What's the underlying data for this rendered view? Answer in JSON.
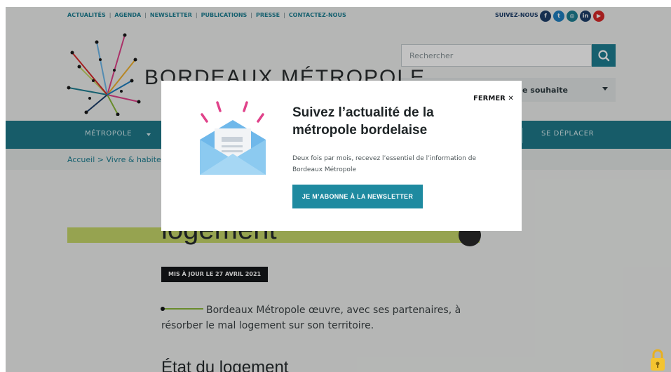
{
  "topbar": {
    "links": [
      "ACTUALITÉS",
      "AGENDA",
      "NEWSLETTER",
      "PUBLICATIONS",
      "PRESSE",
      "CONTACTEZ-NOUS"
    ],
    "follow_label": "SUIVEZ-NOUS",
    "socials": [
      {
        "icon": "facebook-icon",
        "glyph": "f",
        "color": "#1d3e6a"
      },
      {
        "icon": "twitter-icon",
        "glyph": "t",
        "color": "#1d7fc0"
      },
      {
        "icon": "instagram-icon",
        "glyph": "◎",
        "color": "#1d7f93"
      },
      {
        "icon": "linkedin-icon",
        "glyph": "in",
        "color": "#1d3e6a"
      },
      {
        "icon": "youtube-icon",
        "glyph": "▶",
        "color": "#d72a2a"
      }
    ]
  },
  "header": {
    "logo_text": "BORDEAUX MÉTROPOLE",
    "search_placeholder": "Rechercher",
    "select_value": "e souhaite"
  },
  "nav": {
    "items": [
      "MÉTROPOLE",
      "SE DÉPLACER"
    ]
  },
  "breadcrumb": "Accueil > Vivre & habiter >",
  "article": {
    "title": "logement",
    "updated": "MIS À JOUR LE 27 AVRIL 2021",
    "intro": "Bordeaux Métropole œuvre, avec ses partenaires, à résorber le mal logement sur son territoire.",
    "section_heading": "État du logement"
  },
  "modal": {
    "close_label": "FERMER ✕",
    "title": "Suivez l’actualité de la métropole bordelaise",
    "description": "Deux fois par mois, recevez l’essentiel de l’information de Bordeaux Métropole",
    "cta": "JE M’ABONNE À LA NEWSLETTER"
  },
  "colors": {
    "teal": "#1f7a8a",
    "cta": "#1e8aa0",
    "accent_green": "#c5d76a",
    "envelope_blue": "#6fb8ea",
    "pink": "#e0428a"
  }
}
